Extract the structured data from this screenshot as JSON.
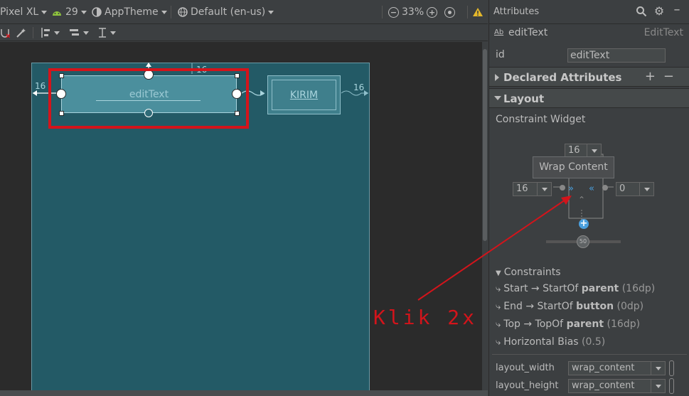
{
  "toolbar": {
    "device": "Pixel XL",
    "api_level": "29",
    "theme": "AppTheme",
    "locale": "Default (en-us)",
    "zoom": "33%"
  },
  "canvas": {
    "edittext_hint": "editText",
    "button_label": "KIRIM",
    "margin_left": "16",
    "margin_top": "16",
    "margin_right": "16"
  },
  "annotation": {
    "text": "Klik 2x",
    "color": "#d3141b"
  },
  "attributes": {
    "title": "Attributes",
    "widget_name": "editText",
    "widget_type": "EditText",
    "id_label": "id",
    "id_value": "editText",
    "declared_section": "Declared Attributes",
    "layout_section": "Layout",
    "constraint_widget_label": "Constraint Widget",
    "inspector": {
      "top_margin": "16",
      "left_margin": "16",
      "right_margin": "0",
      "bias": "50",
      "tooltip": "Wrap Content"
    },
    "constraints_label": "Constraints",
    "constraints": [
      {
        "prefix": "Start → StartOf ",
        "target": "parent",
        "suffix": " (16dp)"
      },
      {
        "prefix": "End → StartOf ",
        "target": "button",
        "suffix": " (0dp)"
      },
      {
        "prefix": "Top → TopOf ",
        "target": "parent",
        "suffix": " (16dp)"
      },
      {
        "prefix": "Horizontal Bias ",
        "target": "",
        "suffix": "(0.5)"
      }
    ],
    "layout_width_label": "layout_width",
    "layout_width_value": "wrap_content",
    "layout_height_label": "layout_height",
    "layout_height_value": "wrap_content"
  }
}
